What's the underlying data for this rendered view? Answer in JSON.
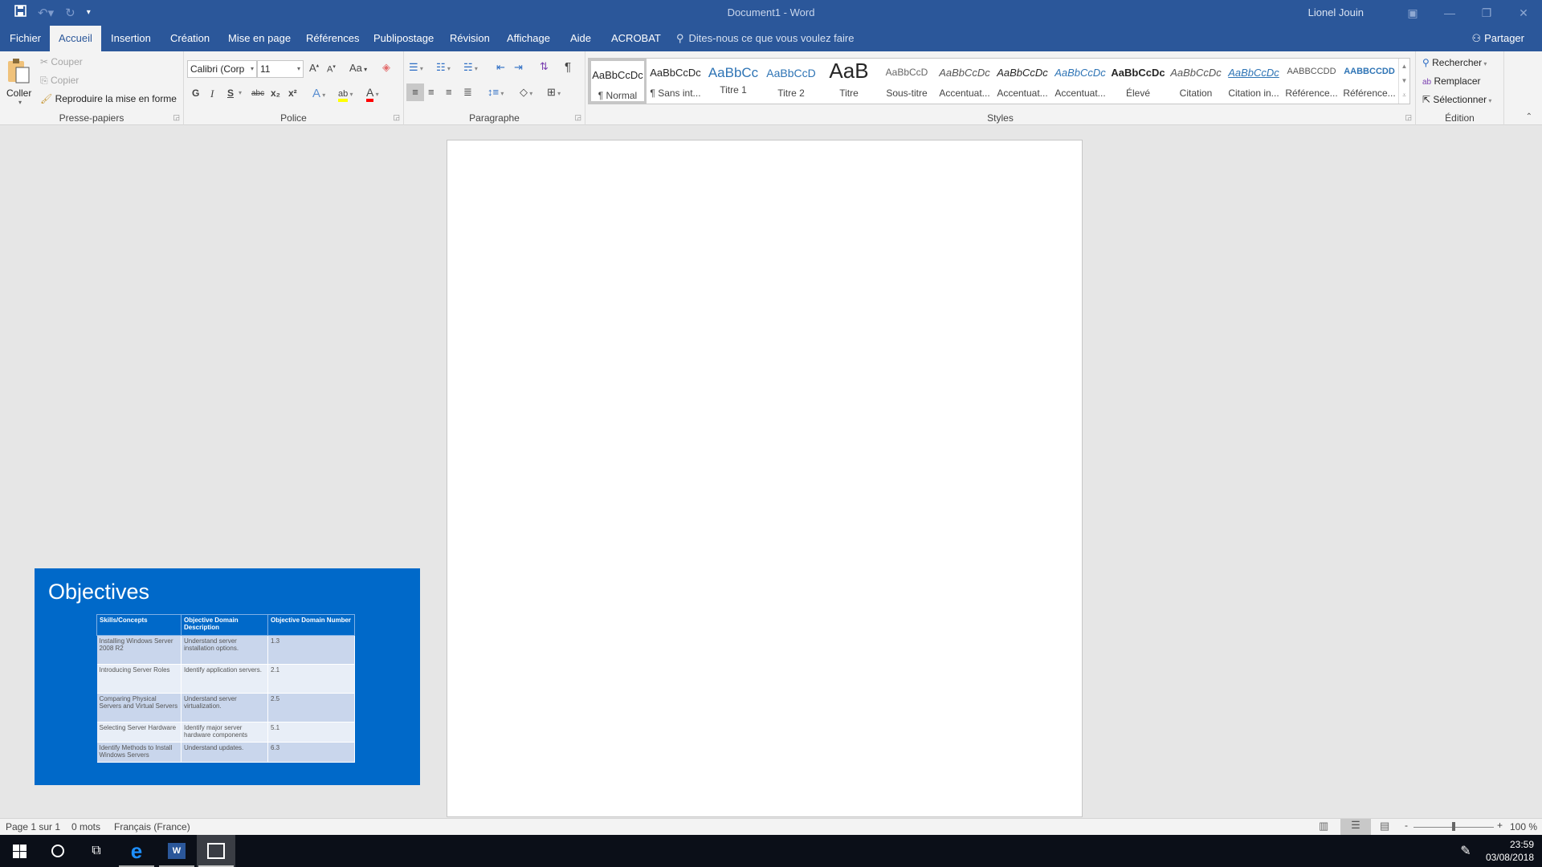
{
  "window": {
    "title": "Document1  -  Word",
    "user": "Lionel Jouin",
    "qat": {
      "save": "save-icon",
      "undo": "undo-icon",
      "redo": "redo-icon",
      "customize": "customize-icon"
    },
    "controls": {
      "ribbon_display": "ribbon-display-icon",
      "minimize": "minimize-icon",
      "restore": "restore-icon",
      "close": "close-icon"
    }
  },
  "tabs": [
    {
      "label": "Fichier"
    },
    {
      "label": "Accueil",
      "active": true
    },
    {
      "label": "Insertion"
    },
    {
      "label": "Création"
    },
    {
      "label": "Mise en page"
    },
    {
      "label": "Références"
    },
    {
      "label": "Publipostage"
    },
    {
      "label": "Révision"
    },
    {
      "label": "Affichage"
    },
    {
      "label": "Aide"
    },
    {
      "label": "ACROBAT"
    }
  ],
  "tell_me": {
    "placeholder": "Dites-nous ce que vous voulez faire"
  },
  "share": {
    "label": "Partager"
  },
  "ribbon": {
    "clipboard": {
      "label": "Presse-papiers",
      "paste": "Coller",
      "cut": "Couper",
      "copy": "Copier",
      "format_painter": "Reproduire la mise en forme"
    },
    "font": {
      "label": "Police",
      "font_name": "Calibri (Corp",
      "font_size": "11",
      "change_case": "Aa",
      "bold": "G",
      "italic": "I",
      "underline": "S",
      "strike": "abc",
      "subscript": "x₂",
      "superscript": "x²",
      "highlight_color": "#ffff00",
      "font_color": "#ff0000"
    },
    "paragraph": {
      "label": "Paragraphe"
    },
    "styles": {
      "label": "Styles",
      "items": [
        {
          "preview": "AaBbCcDc",
          "name": "¶ Normal",
          "selected": true
        },
        {
          "preview": "AaBbCcDc",
          "name": "¶ Sans int..."
        },
        {
          "preview": "AaBbCc",
          "name": "Titre 1"
        },
        {
          "preview": "AaBbCcD",
          "name": "Titre 2"
        },
        {
          "preview": "AaB",
          "name": "Titre"
        },
        {
          "preview": "AaBbCcD",
          "name": "Sous-titre"
        },
        {
          "preview": "AaBbCcDc",
          "name": "Accentuat..."
        },
        {
          "preview": "AaBbCcDc",
          "name": "Accentuat..."
        },
        {
          "preview": "AaBbCcDc",
          "name": "Accentuat..."
        },
        {
          "preview": "AaBbCcDc",
          "name": "Élevé"
        },
        {
          "preview": "AaBbCcDc",
          "name": "Citation"
        },
        {
          "preview": "AaBbCcDc",
          "name": "Citation in..."
        },
        {
          "preview": "AABBCCDD",
          "name": "Référence..."
        },
        {
          "preview": "AABBCCDD",
          "name": "Référence..."
        }
      ]
    },
    "editing": {
      "label": "Édition",
      "find": "Rechercher",
      "replace": "Remplacer",
      "select": "Sélectionner"
    }
  },
  "slide": {
    "title": "Objectives",
    "headers": [
      "Skills/Concepts",
      "Objective Domain Description",
      "Objective Domain Number"
    ],
    "rows": [
      [
        "Installing Windows Server 2008 R2",
        "Understand server installation options.",
        "1.3"
      ],
      [
        "Introducing Server Roles",
        "Identify application servers.",
        "2.1"
      ],
      [
        "Comparing Physical Servers and Virtual Servers",
        "Understand server virtualization.",
        "2.5"
      ],
      [
        "Selecting Server Hardware",
        "Identify major server hardware components",
        "5.1"
      ],
      [
        "Identify Methods to Install Windows Servers",
        "Understand updates.",
        "6.3"
      ]
    ]
  },
  "status": {
    "page": "Page 1 sur 1",
    "words": "0 mots",
    "language": "Français (France)",
    "zoom": "100 %",
    "zoom_minus": "-",
    "zoom_plus": "+"
  },
  "taskbar": {
    "time": "23:59",
    "date": "03/08/2018"
  }
}
